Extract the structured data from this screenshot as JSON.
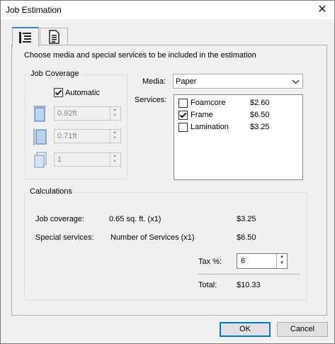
{
  "window": {
    "title": "Job Estimation",
    "close_glyph": "✕"
  },
  "tabs": [
    {
      "icon": "list-settings-icon"
    },
    {
      "icon": "document-list-icon"
    }
  ],
  "instructions": "Choose media and special services to be included in the estimation",
  "job_coverage": {
    "title": "Job Coverage",
    "automatic_label": "Automatic",
    "automatic_checked": true,
    "width_value": "0.92ft",
    "height_value": "0.71ft",
    "copies_value": "1"
  },
  "media": {
    "label": "Media:",
    "selected": "Paper"
  },
  "services": {
    "label": "Services:",
    "items": [
      {
        "name": "Foamcore",
        "price": "$2.60",
        "checked": false
      },
      {
        "name": "Frame",
        "price": "$6.50",
        "checked": true
      },
      {
        "name": "Lamination",
        "price": "$3.25",
        "checked": false
      }
    ]
  },
  "calculations": {
    "title": "Calculations",
    "job_coverage_label": "Job coverage:",
    "job_coverage_detail": "0.65 sq. ft. (x1)",
    "job_coverage_amount": "$3.25",
    "special_label": "Special services:",
    "special_detail": "Number of Services (x1)",
    "special_amount": "$6.50",
    "tax_label": "Tax %:",
    "tax_value": "6",
    "total_label": "Total:",
    "total_amount": "$10.33"
  },
  "buttons": {
    "ok": "OK",
    "cancel": "Cancel"
  }
}
